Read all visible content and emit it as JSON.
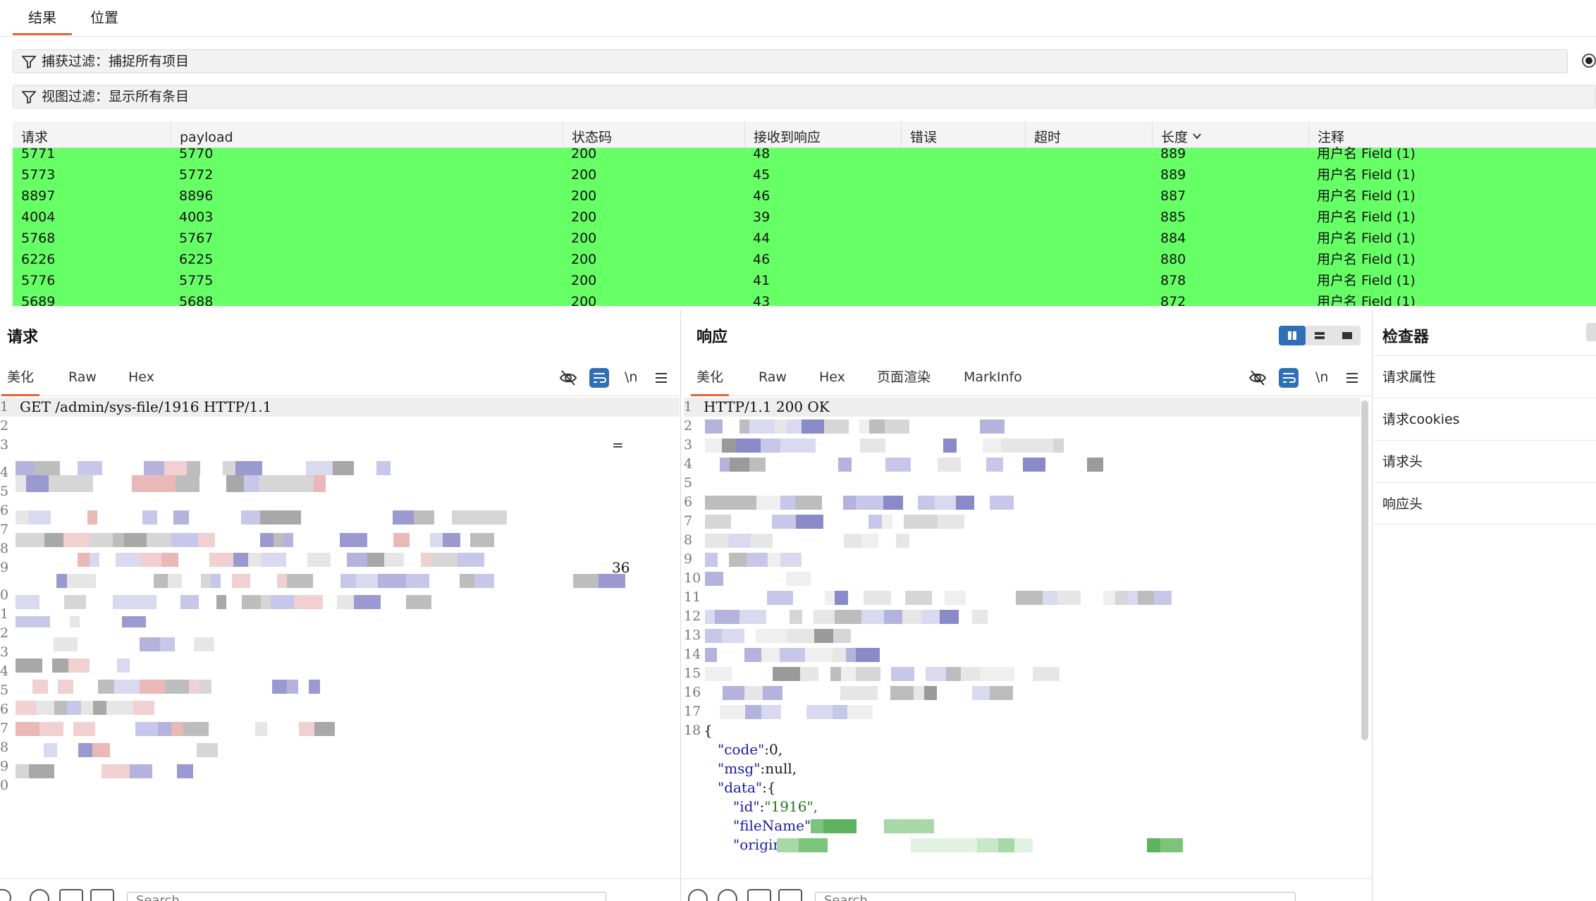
{
  "top_tabs": [
    {
      "label": "结果",
      "active": true
    },
    {
      "label": "位置",
      "active": false
    }
  ],
  "filters": {
    "capture": "捕获过滤：捕捉所有项目",
    "view": "视图过滤：显示所有条目"
  },
  "table": {
    "columns": [
      "请求",
      "payload",
      "状态码",
      "接收到响应",
      "错误",
      "超时",
      "长度",
      "注释"
    ],
    "sorted_column": "长度",
    "row_color": "#66ff66",
    "rows": [
      [
        "5771",
        "5770",
        "200",
        "48",
        "",
        "",
        "889",
        "用户名 Field (1)"
      ],
      [
        "5773",
        "5772",
        "200",
        "45",
        "",
        "",
        "889",
        "用户名 Field (1)"
      ],
      [
        "8897",
        "8896",
        "200",
        "46",
        "",
        "",
        "887",
        "用户名 Field (1)"
      ],
      [
        "4004",
        "4003",
        "200",
        "39",
        "",
        "",
        "885",
        "用户名 Field (1)"
      ],
      [
        "5768",
        "5767",
        "200",
        "44",
        "",
        "",
        "884",
        "用户名 Field (1)"
      ],
      [
        "6226",
        "6225",
        "200",
        "46",
        "",
        "",
        "880",
        "用户名 Field (1)"
      ],
      [
        "5776",
        "5775",
        "200",
        "41",
        "",
        "",
        "878",
        "用户名 Field (1)"
      ],
      [
        "5689",
        "5688",
        "200",
        "43",
        "",
        "",
        "872",
        "用户名 Field (1)"
      ]
    ]
  },
  "request_panel": {
    "title": "请求",
    "tabs": [
      "美化",
      "Raw",
      "Hex"
    ],
    "newline_label": "\\n",
    "lines": [
      {
        "n": "1",
        "text": "GET /admin/sys-file/1916 HTTP/1.1"
      },
      {
        "n": "2",
        "text": ""
      },
      {
        "n": "3",
        "text": "="
      },
      {
        "n": "4",
        "text": ""
      },
      {
        "n": "5",
        "text": ""
      },
      {
        "n": "6",
        "text": ""
      },
      {
        "n": "7",
        "text": ""
      },
      {
        "n": "8",
        "text": ""
      },
      {
        "n": "9",
        "text": "36"
      },
      {
        "n": "0",
        "text": ""
      },
      {
        "n": "1",
        "text": ""
      },
      {
        "n": "2",
        "text": ""
      },
      {
        "n": "3",
        "text": ""
      },
      {
        "n": "4",
        "text": ""
      },
      {
        "n": "5",
        "text": ""
      },
      {
        "n": "6",
        "text": ""
      },
      {
        "n": "7",
        "text": ""
      },
      {
        "n": "8",
        "text": ""
      },
      {
        "n": "9",
        "text": ""
      },
      {
        "n": "0",
        "text": ""
      }
    ]
  },
  "response_panel": {
    "title": "响应",
    "tabs": [
      "美化",
      "Raw",
      "Hex",
      "页面渲染",
      "MarkInfo"
    ],
    "newline_label": "\\n",
    "line_numbers": [
      "1",
      "2",
      "3",
      "4",
      "5",
      "6",
      "7",
      "8",
      "9",
      "10",
      "11",
      "12",
      "13",
      "14",
      "15",
      "16",
      "17",
      "18"
    ],
    "status_line": "HTTP/1.1 200 OK",
    "json": {
      "open": "{",
      "code_key": "\"code\"",
      "code_val": "0,",
      "msg_key": "\"msg\"",
      "msg_val": "null,",
      "data_key": "\"data\"",
      "data_open": "{",
      "id_key": "\"id\"",
      "id_val": "\"1916\",",
      "filename_key": "\"fileName\"",
      "original_key": "\"original\"",
      "colon": ":"
    }
  },
  "inspector": {
    "title": "检查器",
    "items": [
      "请求属性",
      "请求cookies",
      "请求头",
      "响应头"
    ]
  },
  "search": {
    "placeholder": "Search"
  },
  "colors": {
    "accent": "#e0633a",
    "button_blue": "#2f6fb5",
    "match_row": "#66ff66"
  }
}
